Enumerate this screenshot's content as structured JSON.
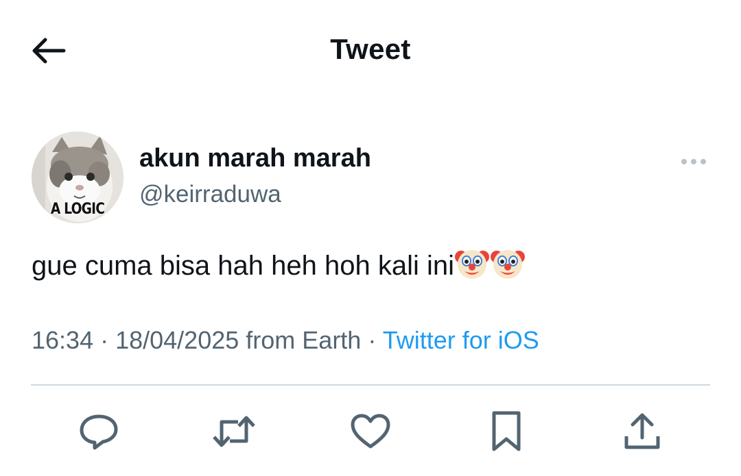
{
  "header": {
    "title": "Tweet",
    "back_icon": "arrow-left-icon"
  },
  "author": {
    "display_name": "akun marah marah",
    "handle": "@keirraduwa",
    "avatar_caption": "A LOGIC",
    "more_icon": "more-horizontal-icon"
  },
  "tweet": {
    "text": "gue cuma bisa hah heh hoh kali ini",
    "emoji_count": 2,
    "emoji_icon": "clown-face-emoji"
  },
  "meta": {
    "time": "16:34",
    "separator": " · ",
    "date": "18/04/2025",
    "location": " from Earth",
    "source": "Twitter for iOS"
  },
  "actions": [
    {
      "name": "reply",
      "icon": "reply-icon"
    },
    {
      "name": "retweet",
      "icon": "retweet-icon"
    },
    {
      "name": "like",
      "icon": "heart-icon"
    },
    {
      "name": "bookmark",
      "icon": "bookmark-icon"
    },
    {
      "name": "share",
      "icon": "share-icon"
    }
  ],
  "colors": {
    "text": "#0f1419",
    "secondary": "#536471",
    "link": "#1d9bf0",
    "divider": "#cfd9de"
  }
}
